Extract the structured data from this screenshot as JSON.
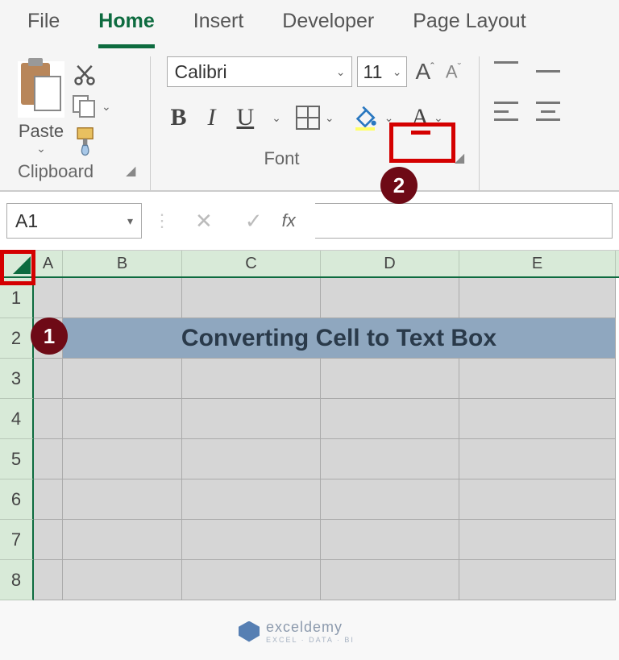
{
  "tabs": [
    "File",
    "Home",
    "Insert",
    "Developer",
    "Page Layout"
  ],
  "active_tab": "Home",
  "clipboard": {
    "paste_label": "Paste",
    "group_label": "Clipboard"
  },
  "font": {
    "name": "Calibri",
    "size": "11",
    "bold": "B",
    "italic": "I",
    "underline": "U",
    "group_label": "Font"
  },
  "name_box": "A1",
  "fx_label": "fx",
  "columns": [
    "A",
    "B",
    "C",
    "D",
    "E"
  ],
  "rows": [
    "1",
    "2",
    "3",
    "4",
    "5",
    "6",
    "7",
    "8"
  ],
  "title_cell": "Converting Cell to Text Box",
  "badges": {
    "one": "1",
    "two": "2"
  },
  "watermark": {
    "brand": "exceldemy",
    "tagline": "EXCEL · DATA · BI"
  },
  "chart_data": null
}
